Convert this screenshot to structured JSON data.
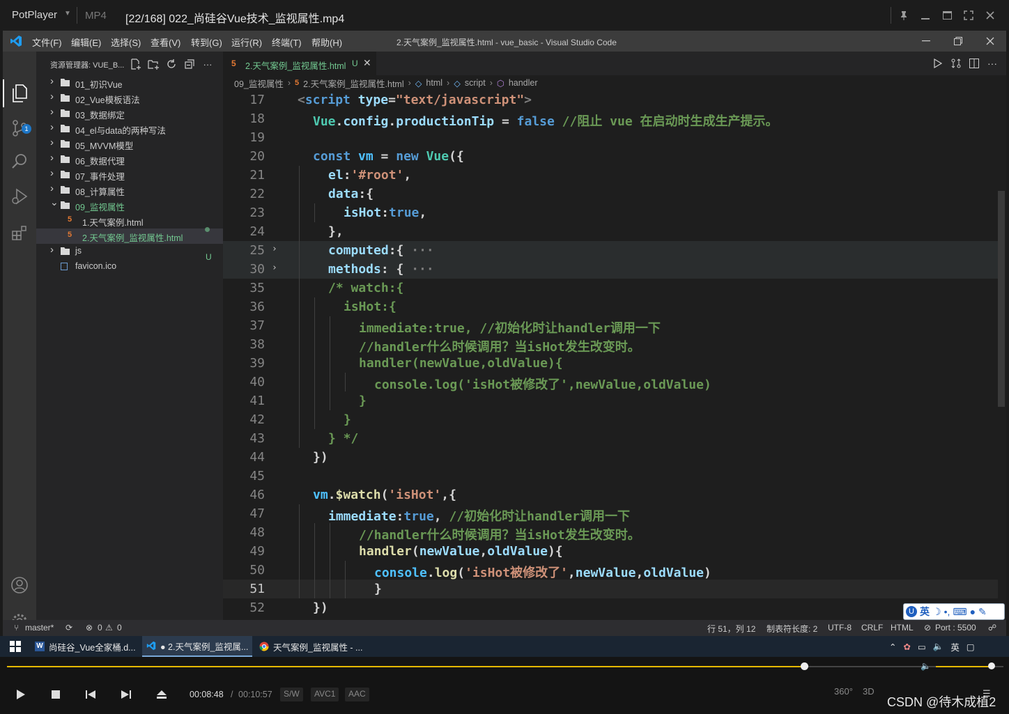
{
  "potplayer": {
    "brand": "PotPlayer",
    "format": "MP4",
    "file_title": "[22/168] 022_尚硅谷Vue技术_监视属性.mp4"
  },
  "vscode": {
    "menu": [
      "文件(F)",
      "编辑(E)",
      "选择(S)",
      "查看(V)",
      "转到(G)",
      "运行(R)",
      "终端(T)",
      "帮助(H)"
    ],
    "window_title": "2.天气案例_监视属性.html - vue_basic - Visual Studio Code",
    "explorer_title": "资源管理器: VUE_B...",
    "tree": [
      {
        "label": "01_初识Vue",
        "type": "folder"
      },
      {
        "label": "02_Vue模板语法",
        "type": "folder"
      },
      {
        "label": "03_数据绑定",
        "type": "folder"
      },
      {
        "label": "04_el与data的两种写法",
        "type": "folder"
      },
      {
        "label": "05_MVVM模型",
        "type": "folder"
      },
      {
        "label": "06_数据代理",
        "type": "folder"
      },
      {
        "label": "07_事件处理",
        "type": "folder"
      },
      {
        "label": "08_计算属性",
        "type": "folder"
      },
      {
        "label": "09_监视属性",
        "type": "folder-open"
      },
      {
        "label": "1.天气案例.html",
        "type": "html"
      },
      {
        "label": "2.天气案例_监视属性.html",
        "type": "html-selected"
      },
      {
        "label": "js",
        "type": "folder"
      },
      {
        "label": "favicon.ico",
        "type": "file"
      }
    ],
    "tree_badge": "U",
    "tab": {
      "label": "2.天气案例_监视属性.html",
      "status": "U"
    },
    "breadcrumbs": [
      "09_监视属性",
      "2.天气案例_监视属性.html",
      "html",
      "script",
      "handler"
    ],
    "scm_badge": "1",
    "code_lines": [
      {
        "n": "17",
        "html": "<span class='tk-gray'>&lt;</span><span class='tk-tag'>script</span> <span class='tk-attr'>type</span>=<span class='tk-str'>\"text/javascript\"</span><span class='tk-gray'>&gt;</span>",
        "indent": 0
      },
      {
        "n": "18",
        "html": "<span class='tk-cls'>Vue</span>.<span class='tk-prop'>config</span>.<span class='tk-prop'>productionTip</span> = <span class='tk-bool'>false</span> <span class='tk-com'>//阻止 vue 在启动时生成生产提示。</span>",
        "indent": 1
      },
      {
        "n": "19",
        "html": "",
        "indent": 0
      },
      {
        "n": "20",
        "html": "<span class='tk-kw'>const</span> <span class='tk-var'>vm</span> = <span class='tk-kw'>new</span> <span class='tk-cls'>Vue</span>({",
        "indent": 1
      },
      {
        "n": "21",
        "html": "<span class='tk-prop'>el</span>:<span class='tk-str'>'#root'</span>,",
        "indent": 2
      },
      {
        "n": "22",
        "html": "<span class='tk-prop'>data</span>:{",
        "indent": 2
      },
      {
        "n": "23",
        "html": "<span class='tk-prop'>isHot</span>:<span class='tk-bool'>true</span>,",
        "indent": 3
      },
      {
        "n": "24",
        "html": "},",
        "indent": 2
      },
      {
        "n": "25",
        "html": "<span class='tk-prop'>computed</span>:{<span class='tk-gray'> ···</span>",
        "indent": 2,
        "fold": true
      },
      {
        "n": "30",
        "html": "<span class='tk-prop'>methods</span>: {<span class='tk-gray'> ···</span>",
        "indent": 2,
        "fold": true
      },
      {
        "n": "35",
        "html": "<span class='tk-com'>/* watch:{</span>",
        "indent": 2
      },
      {
        "n": "36",
        "html": "<span class='tk-com'>isHot:{</span>",
        "indent": 3
      },
      {
        "n": "37",
        "html": "<span class='tk-com'>immediate:true, //初始化时让handler调用一下</span>",
        "indent": 4
      },
      {
        "n": "38",
        "html": "<span class='tk-com'>//handler什么时候调用？当isHot发生改变时。</span>",
        "indent": 4
      },
      {
        "n": "39",
        "html": "<span class='tk-com'>handler(newValue,oldValue){</span>",
        "indent": 4
      },
      {
        "n": "40",
        "html": "<span class='tk-com'>console.log('isHot被修改了',newValue,oldValue)</span>",
        "indent": 5
      },
      {
        "n": "41",
        "html": "<span class='tk-com'>}</span>",
        "indent": 4
      },
      {
        "n": "42",
        "html": "<span class='tk-com'>}</span>",
        "indent": 3
      },
      {
        "n": "43",
        "html": "<span class='tk-com'>} */</span>",
        "indent": 2
      },
      {
        "n": "44",
        "html": "})",
        "indent": 1
      },
      {
        "n": "45",
        "html": "",
        "indent": 0
      },
      {
        "n": "46",
        "html": "<span class='tk-var'>vm</span>.<span class='tk-fn'>$watch</span>(<span class='tk-str'>'isHot'</span>,{",
        "indent": 1
      },
      {
        "n": "47",
        "html": "<span class='tk-prop'>immediate</span>:<span class='tk-bool'>true</span>, <span class='tk-com'>//初始化时让handler调用一下</span>",
        "indent": 2
      },
      {
        "n": "48",
        "html": "<span class='tk-com'>//handler什么时候调用？当isHot发生改变时。</span>",
        "indent": 4
      },
      {
        "n": "49",
        "html": "<span class='tk-fn'>handler</span>(<span class='tk-attr'>newValue</span>,<span class='tk-attr'>oldValue</span>){",
        "indent": 4
      },
      {
        "n": "50",
        "html": "<span class='tk-var'>console</span>.<span class='tk-fn'>log</span>(<span class='tk-str'>'isHot被修改了'</span>,<span class='tk-attr'>newValue</span>,<span class='tk-attr'>oldValue</span>)",
        "indent": 5
      },
      {
        "n": "51",
        "html": "}",
        "indent": 5,
        "current": true
      },
      {
        "n": "52",
        "html": "})",
        "indent": 1
      }
    ],
    "status": {
      "branch": "master*",
      "errors": "0",
      "warnings": "0",
      "position": "行 51，列 12",
      "tab_size": "制表符长度: 2",
      "encoding": "UTF-8",
      "eol": "CRLF",
      "language": "HTML",
      "port": "Port : 5500"
    },
    "ime": {
      "lang": "英"
    }
  },
  "taskbar": {
    "items": [
      "尚硅谷_Vue全家桶.d...",
      "● 2.天气案例_监视属...",
      "天气案例_监视属性 - ..."
    ],
    "ime_lang": "英"
  },
  "player": {
    "time_current": "00:08:48",
    "time_sep": "/",
    "time_total": "00:10:57",
    "tags": [
      "S/W",
      "AVC1",
      "AAC"
    ],
    "right_tags": [
      "360°",
      "3D"
    ],
    "progress": 0.8,
    "volume": 1.0,
    "watermark": "CSDN @待木成植2"
  }
}
